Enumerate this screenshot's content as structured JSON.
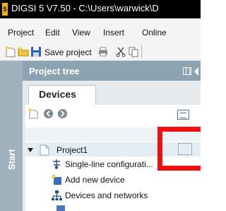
{
  "window": {
    "title": "DIGSI 5 V7.50 - C:\\Users\\warwick\\D",
    "icon_letter": "5"
  },
  "menu": {
    "items": [
      "Project",
      "Edit",
      "View",
      "Insert",
      "Online"
    ]
  },
  "toolbar": {
    "save_label": "Save project",
    "icons": [
      "new-project-icon",
      "open-project-icon",
      "save-icon",
      "print-icon",
      "cut-icon",
      "copy-icon"
    ]
  },
  "sidebar": {
    "start_label": "Start"
  },
  "project_tree": {
    "title": "Project tree",
    "tab_label": "Devices",
    "items": [
      {
        "label": "Project1",
        "icon": "project-icon",
        "expanded": true
      },
      {
        "label": "Single-line configurati...",
        "icon": "single-line-icon"
      },
      {
        "label": "Add new device",
        "icon": "add-device-icon"
      },
      {
        "label": "Devices and networks",
        "icon": "network-icon"
      }
    ]
  },
  "colors": {
    "title_bar": "#000000",
    "panel_header": "#8ca3b1",
    "start_strip": "#9fb2bd",
    "highlight_frame": "#ee1111"
  }
}
